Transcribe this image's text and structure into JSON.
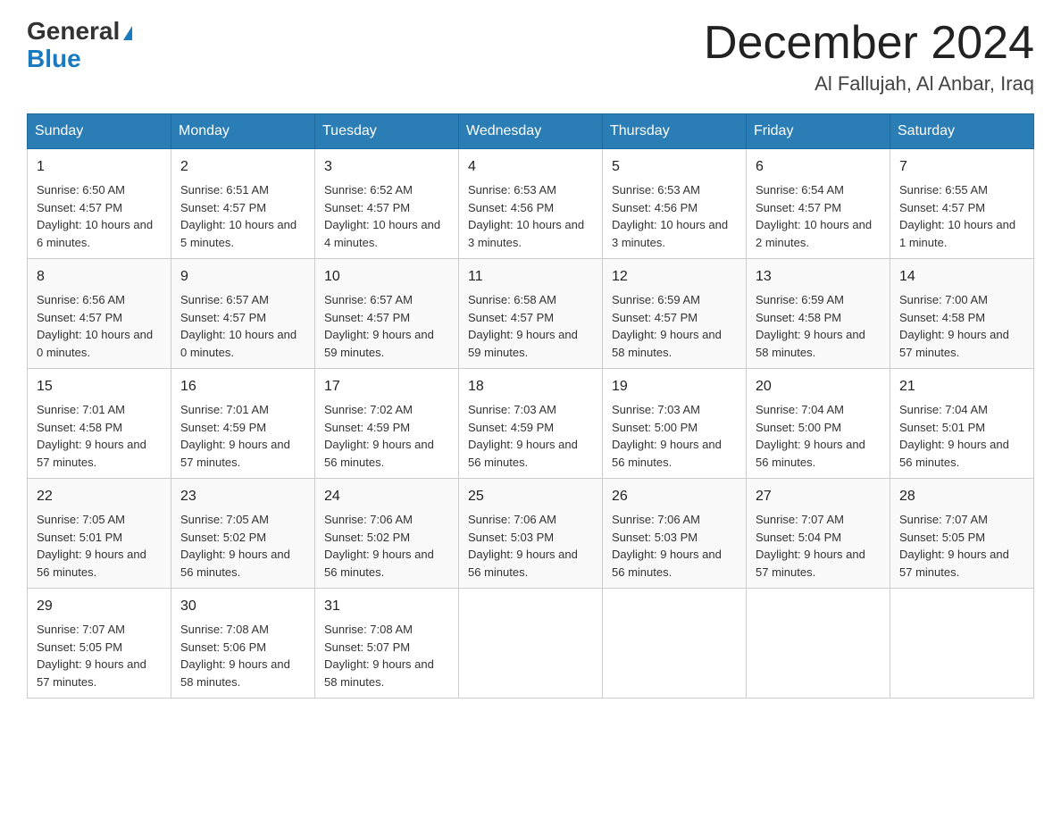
{
  "header": {
    "logo_general": "General",
    "logo_blue": "Blue",
    "month_title": "December 2024",
    "location": "Al Fallujah, Al Anbar, Iraq"
  },
  "weekdays": [
    "Sunday",
    "Monday",
    "Tuesday",
    "Wednesday",
    "Thursday",
    "Friday",
    "Saturday"
  ],
  "weeks": [
    [
      {
        "day": "1",
        "sunrise": "6:50 AM",
        "sunset": "4:57 PM",
        "daylight": "10 hours and 6 minutes."
      },
      {
        "day": "2",
        "sunrise": "6:51 AM",
        "sunset": "4:57 PM",
        "daylight": "10 hours and 5 minutes."
      },
      {
        "day": "3",
        "sunrise": "6:52 AM",
        "sunset": "4:57 PM",
        "daylight": "10 hours and 4 minutes."
      },
      {
        "day": "4",
        "sunrise": "6:53 AM",
        "sunset": "4:56 PM",
        "daylight": "10 hours and 3 minutes."
      },
      {
        "day": "5",
        "sunrise": "6:53 AM",
        "sunset": "4:56 PM",
        "daylight": "10 hours and 3 minutes."
      },
      {
        "day": "6",
        "sunrise": "6:54 AM",
        "sunset": "4:57 PM",
        "daylight": "10 hours and 2 minutes."
      },
      {
        "day": "7",
        "sunrise": "6:55 AM",
        "sunset": "4:57 PM",
        "daylight": "10 hours and 1 minute."
      }
    ],
    [
      {
        "day": "8",
        "sunrise": "6:56 AM",
        "sunset": "4:57 PM",
        "daylight": "10 hours and 0 minutes."
      },
      {
        "day": "9",
        "sunrise": "6:57 AM",
        "sunset": "4:57 PM",
        "daylight": "10 hours and 0 minutes."
      },
      {
        "day": "10",
        "sunrise": "6:57 AM",
        "sunset": "4:57 PM",
        "daylight": "9 hours and 59 minutes."
      },
      {
        "day": "11",
        "sunrise": "6:58 AM",
        "sunset": "4:57 PM",
        "daylight": "9 hours and 59 minutes."
      },
      {
        "day": "12",
        "sunrise": "6:59 AM",
        "sunset": "4:57 PM",
        "daylight": "9 hours and 58 minutes."
      },
      {
        "day": "13",
        "sunrise": "6:59 AM",
        "sunset": "4:58 PM",
        "daylight": "9 hours and 58 minutes."
      },
      {
        "day": "14",
        "sunrise": "7:00 AM",
        "sunset": "4:58 PM",
        "daylight": "9 hours and 57 minutes."
      }
    ],
    [
      {
        "day": "15",
        "sunrise": "7:01 AM",
        "sunset": "4:58 PM",
        "daylight": "9 hours and 57 minutes."
      },
      {
        "day": "16",
        "sunrise": "7:01 AM",
        "sunset": "4:59 PM",
        "daylight": "9 hours and 57 minutes."
      },
      {
        "day": "17",
        "sunrise": "7:02 AM",
        "sunset": "4:59 PM",
        "daylight": "9 hours and 56 minutes."
      },
      {
        "day": "18",
        "sunrise": "7:03 AM",
        "sunset": "4:59 PM",
        "daylight": "9 hours and 56 minutes."
      },
      {
        "day": "19",
        "sunrise": "7:03 AM",
        "sunset": "5:00 PM",
        "daylight": "9 hours and 56 minutes."
      },
      {
        "day": "20",
        "sunrise": "7:04 AM",
        "sunset": "5:00 PM",
        "daylight": "9 hours and 56 minutes."
      },
      {
        "day": "21",
        "sunrise": "7:04 AM",
        "sunset": "5:01 PM",
        "daylight": "9 hours and 56 minutes."
      }
    ],
    [
      {
        "day": "22",
        "sunrise": "7:05 AM",
        "sunset": "5:01 PM",
        "daylight": "9 hours and 56 minutes."
      },
      {
        "day": "23",
        "sunrise": "7:05 AM",
        "sunset": "5:02 PM",
        "daylight": "9 hours and 56 minutes."
      },
      {
        "day": "24",
        "sunrise": "7:06 AM",
        "sunset": "5:02 PM",
        "daylight": "9 hours and 56 minutes."
      },
      {
        "day": "25",
        "sunrise": "7:06 AM",
        "sunset": "5:03 PM",
        "daylight": "9 hours and 56 minutes."
      },
      {
        "day": "26",
        "sunrise": "7:06 AM",
        "sunset": "5:03 PM",
        "daylight": "9 hours and 56 minutes."
      },
      {
        "day": "27",
        "sunrise": "7:07 AM",
        "sunset": "5:04 PM",
        "daylight": "9 hours and 57 minutes."
      },
      {
        "day": "28",
        "sunrise": "7:07 AM",
        "sunset": "5:05 PM",
        "daylight": "9 hours and 57 minutes."
      }
    ],
    [
      {
        "day": "29",
        "sunrise": "7:07 AM",
        "sunset": "5:05 PM",
        "daylight": "9 hours and 57 minutes."
      },
      {
        "day": "30",
        "sunrise": "7:08 AM",
        "sunset": "5:06 PM",
        "daylight": "9 hours and 58 minutes."
      },
      {
        "day": "31",
        "sunrise": "7:08 AM",
        "sunset": "5:07 PM",
        "daylight": "9 hours and 58 minutes."
      },
      null,
      null,
      null,
      null
    ]
  ]
}
